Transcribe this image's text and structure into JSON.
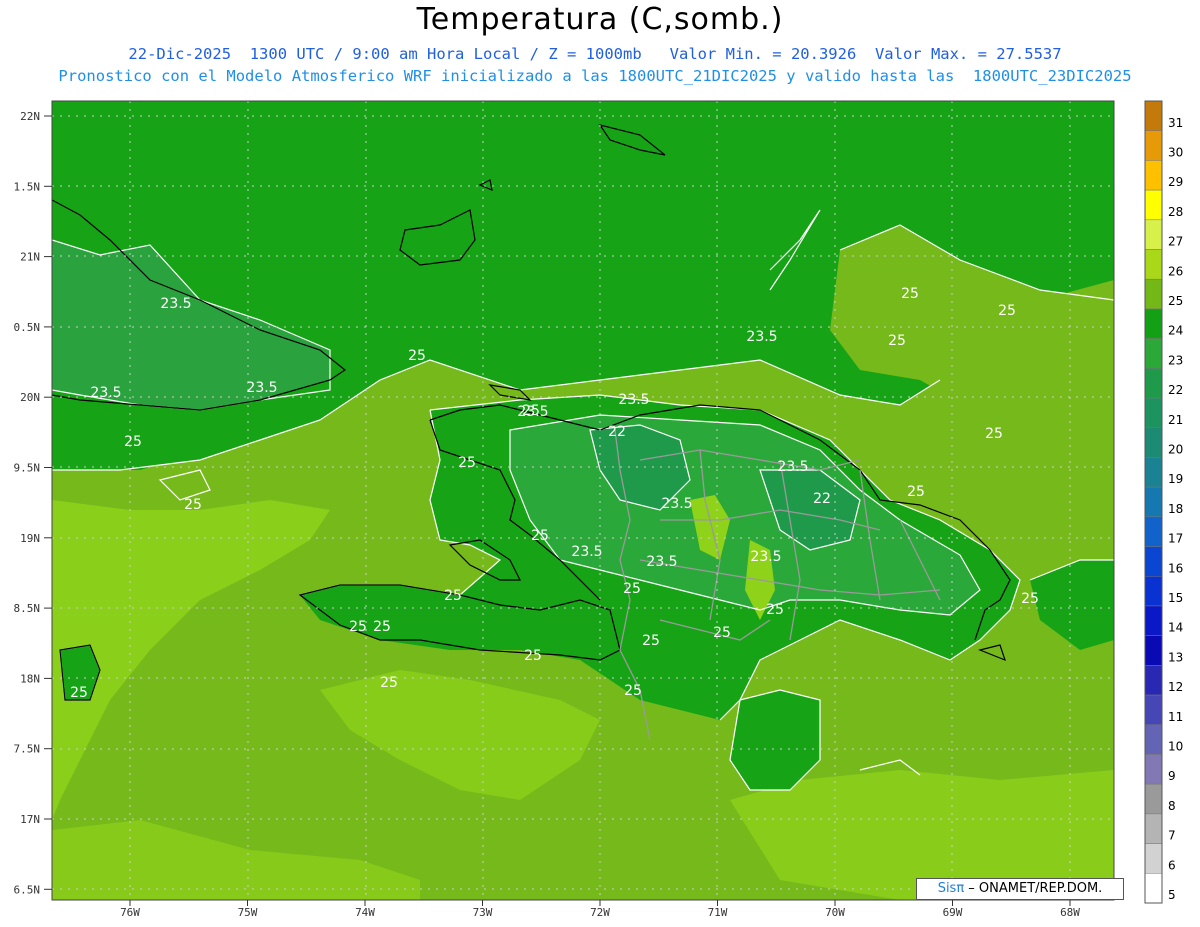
{
  "header": {
    "title": "Temperatura (C,somb.)",
    "subtitle": "22-Dic-2025  1300 UTC / 9:00 am Hora Local / Z = 1000mb   Valor Min. = 20.3926  Valor Max. = 27.5537",
    "model_info": "Pronostico con el Modelo Atmosferico WRF inicializado a las 1800UTC_21DIC2025 y valido hasta las  1800UTC_23DIC2025"
  },
  "map": {
    "lat_labels": [
      "22N",
      "1.5N",
      "21N",
      "0.5N",
      "20N",
      "9.5N",
      "19N",
      "8.5N",
      "18N",
      "7.5N",
      "17N",
      "6.5N"
    ],
    "lon_labels": [
      "76W",
      "75W",
      "74W",
      "73W",
      "72W",
      "71W",
      "70W",
      "69W",
      "68W"
    ],
    "contour_labels": [
      "23.5",
      "23.5",
      "23.5",
      "25",
      "25",
      "25",
      "25",
      "25",
      "23.5",
      "23.5",
      "22",
      "23.5",
      "23.5",
      "22",
      "23.5",
      "23.5",
      "23.5",
      "23.5",
      "25",
      "25",
      "25",
      "25",
      "25",
      "25",
      "25",
      "25",
      "25",
      "25",
      "25",
      "25",
      "25",
      "25",
      "25",
      "25",
      "25",
      "25"
    ],
    "colors": {
      "sea_warm": "#75ba1a",
      "green_24": "#16a316",
      "green_23": "#2aa830",
      "green_22": "#1f9a4a",
      "lime_26": "#8ed21a",
      "border": "#000000",
      "provinces": "#9a9a9a",
      "contour": "#ffffff"
    }
  },
  "colorbar": {
    "labels": [
      "31",
      "30",
      "29",
      "28",
      "27",
      "26",
      "25",
      "24",
      "23",
      "22",
      "21",
      "20",
      "19",
      "18",
      "17",
      "16",
      "15",
      "14",
      "13",
      "12",
      "11",
      "10",
      "9",
      "8",
      "7",
      "6",
      "5"
    ],
    "colors": [
      "#c47a0a",
      "#e69a08",
      "#ffc000",
      "#ffff00",
      "#d8f04a",
      "#a8d818",
      "#74b818",
      "#14a014",
      "#2ca838",
      "#1f9a4a",
      "#1d9460",
      "#1d8a74",
      "#1a8292",
      "#1578b0",
      "#1262cc",
      "#0a46d2",
      "#0a32d2",
      "#0a18c8",
      "#0a0ab4",
      "#2828b4",
      "#4646b4",
      "#6464b4",
      "#8278b4",
      "#9a9a9a",
      "#b4b4b4",
      "#d2d2d2",
      "#ffffff"
    ]
  },
  "credit": {
    "logo": "Sisπ",
    "text": " – ONAMET/REP.DOM."
  }
}
